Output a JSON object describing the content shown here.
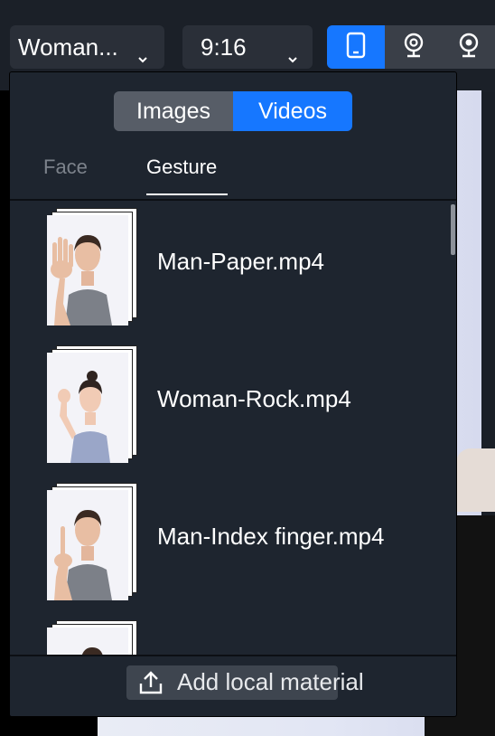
{
  "toolbar": {
    "material_select": "Woman...",
    "ratio_select": "9:16",
    "device_buttons": [
      {
        "icon": "phone-icon",
        "active": true
      },
      {
        "icon": "webcam-icon",
        "active": false
      },
      {
        "icon": "webcam-icon",
        "active": false
      }
    ],
    "accent_color": "#1677ff"
  },
  "panel": {
    "media_tabs": {
      "images": "Images",
      "videos": "Videos",
      "selected": "Videos"
    },
    "category_tabs": {
      "face": "Face",
      "gesture": "Gesture",
      "selected": "Gesture"
    },
    "items": [
      {
        "name": "Man-Paper.mp4",
        "gesture": "open-palm",
        "person": "man"
      },
      {
        "name": "Woman-Rock.mp4",
        "gesture": "fist",
        "person": "woman"
      },
      {
        "name": "Man-Index finger.mp4",
        "gesture": "index-finger",
        "person": "man"
      },
      {
        "name": "",
        "person": "woman"
      }
    ],
    "add_button": "Add local material"
  }
}
